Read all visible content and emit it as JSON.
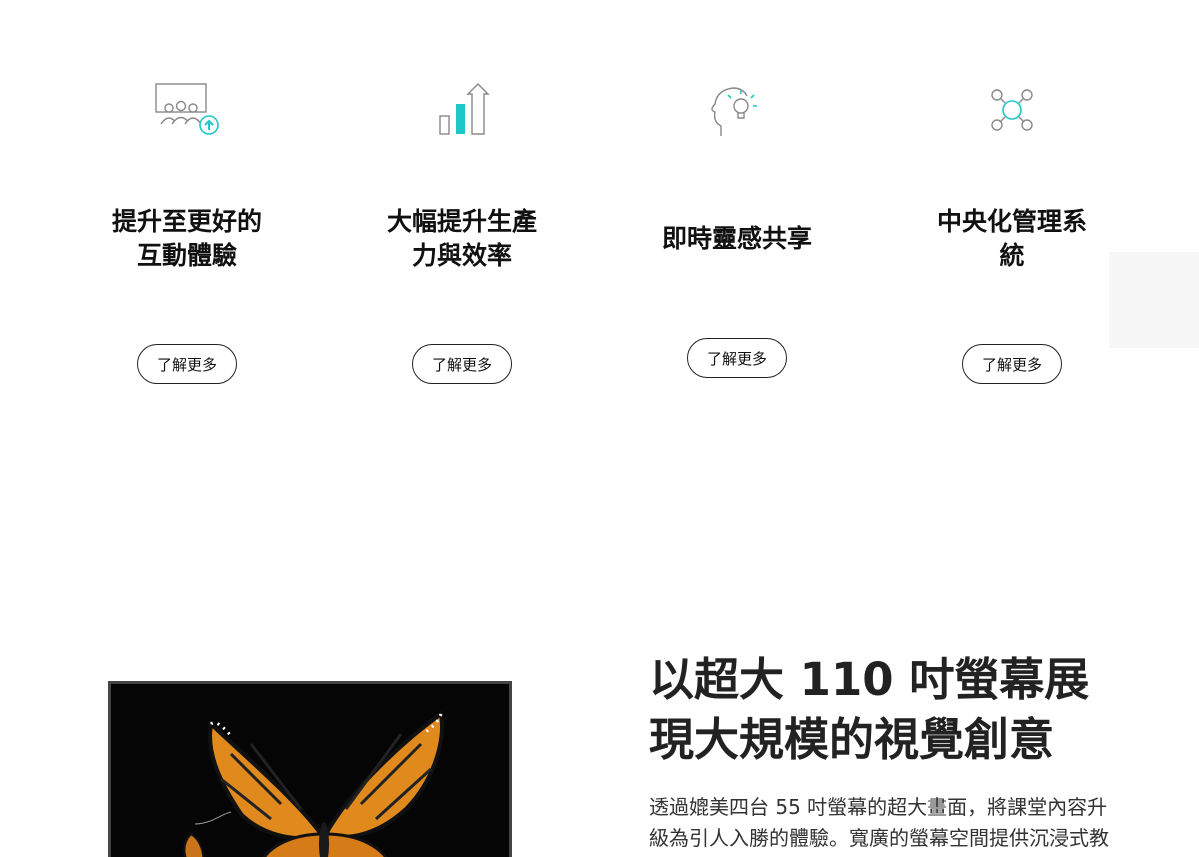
{
  "features": [
    {
      "icon": "audience-upgrade-icon",
      "title_line1": "提升至更好的",
      "title_line2": "互動體驗",
      "button_label": "了解更多"
    },
    {
      "icon": "growth-chart-icon",
      "title_line1": "大幅提升生產",
      "title_line2": "力與效率",
      "button_label": "了解更多"
    },
    {
      "icon": "idea-head-icon",
      "title_line1": "即時靈感共享",
      "title_line2": "",
      "button_label": "了解更多"
    },
    {
      "icon": "network-hub-icon",
      "title_line1": "中央化管理系",
      "title_line2": "統",
      "button_label": "了解更多"
    }
  ],
  "section": {
    "headline_line1": "以超大 110 吋螢幕展",
    "headline_line2": "現大規模的視覺創意",
    "body_line1": "透過媲美四台 55 吋螢幕的超大畫面，將課堂內容升",
    "body_line2": "級為引人入勝的體驗。寬廣的螢幕空間提供沉浸式教"
  },
  "colors": {
    "accent": "#1ec8c8",
    "text": "#111111",
    "line_icon": "#888888"
  }
}
